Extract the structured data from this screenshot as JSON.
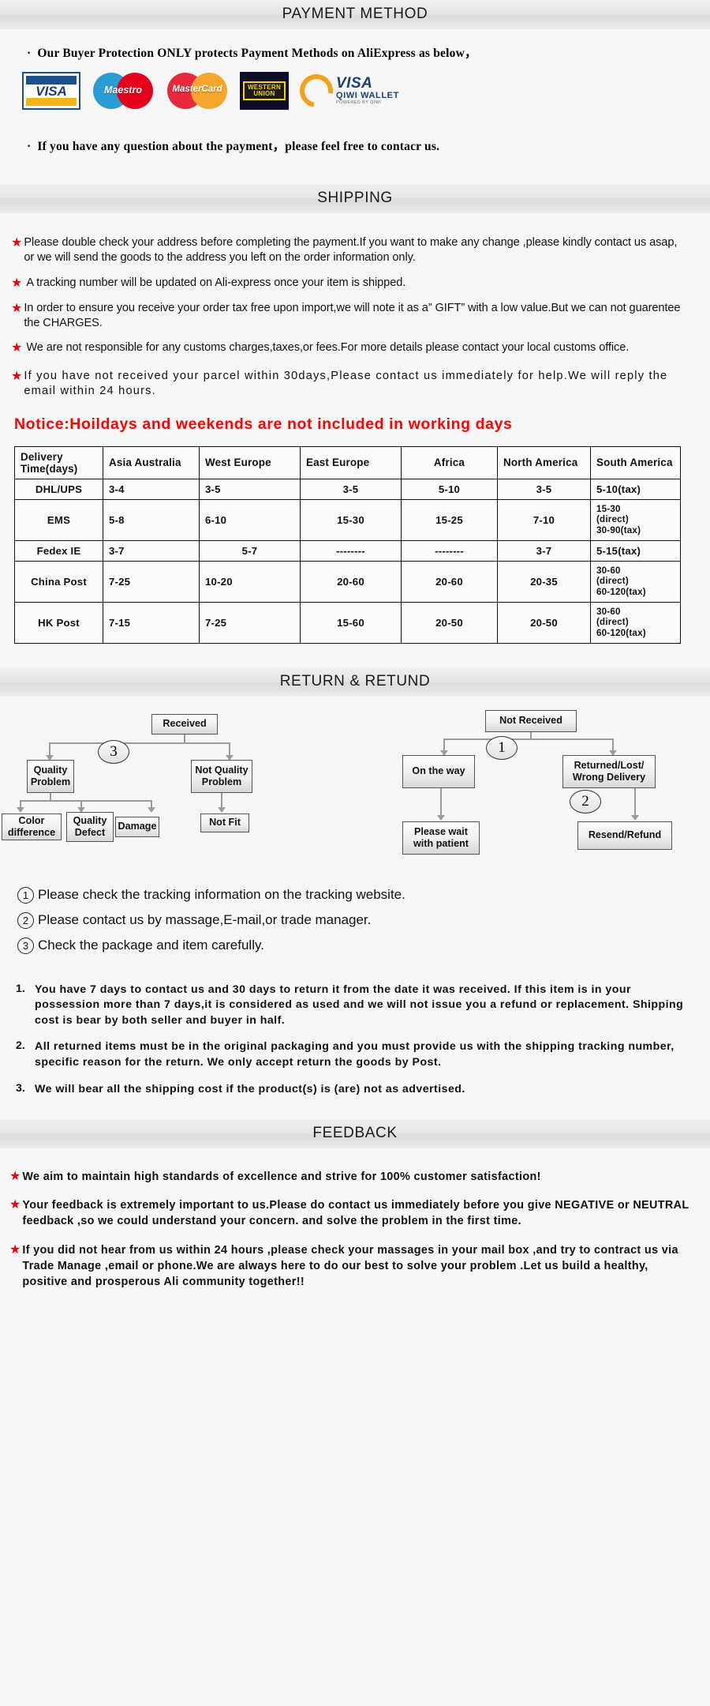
{
  "sections": {
    "payment_title": "PAYMENT METHOD",
    "shipping_title": "SHIPPING",
    "return_title": "RETURN & RETUND",
    "feedback_title": "FEEDBACK"
  },
  "payment": {
    "bullet_dot": "·",
    "line1": "Our Buyer Protection ONLY protects Payment Methods on AliExpress as below，",
    "line2": "If you have any question about the payment，please feel free to contacr us.",
    "logos": [
      {
        "name": "visa-logo",
        "label": "VISA"
      },
      {
        "name": "maestro-logo",
        "label": "Maestro"
      },
      {
        "name": "mastercard-logo",
        "label": "MasterCard"
      },
      {
        "name": "western-union-logo",
        "label_top": "WESTERN",
        "label_bottom": "UNION"
      },
      {
        "name": "qiwi-wallet-logo",
        "label": "VISA",
        "sub": "QIWI WALLET",
        "fine": "POWERED BY QIWI"
      }
    ]
  },
  "shipping": {
    "star": "★",
    "bullets": [
      {
        "text": "Please double check your address before completing the payment.If you want to make any change ,please kindly contact us asap, or we will send the goods to the address you left on the order information only.",
        "wide": false
      },
      {
        "text": "A tracking number will be updated on Ali-express once your item is shipped.",
        "wide": false
      },
      {
        "text": "In order to ensure you receive your order tax free upon import,we will note it as a” GIFT” with a low value.But we can not guarentee the CHARGES.",
        "wide": false
      },
      {
        "text": "We are not responsible for any customs charges,taxes,or fees.For more details please contact your local customs office.",
        "wide": false
      },
      {
        "text": "If you have not received your parcel within 30days,Please contact us immediately for help.We will reply the email within 24 hours.",
        "wide": true
      }
    ],
    "notice": "Notice:Hoildays and weekends are not included in working days",
    "table": {
      "headers": [
        "Delivery Time(days)",
        "Asia Australia",
        "West Europe",
        "East Europe",
        "Africa",
        "North America",
        "South America"
      ],
      "rows": [
        {
          "method": "DHL/UPS",
          "cells": [
            "3-4",
            "3-5",
            "3-5",
            "5-10",
            "3-5",
            "5-10(tax)"
          ]
        },
        {
          "method": "EMS",
          "cells": [
            "5-8",
            "6-10",
            "15-30",
            "15-25",
            "7-10",
            "15-30\n(direct)\n30-90(tax)"
          ]
        },
        {
          "method": "Fedex IE",
          "cells": [
            "3-7",
            "5-7",
            "--------",
            "--------",
            "3-7",
            "5-15(tax)"
          ]
        },
        {
          "method": "China Post",
          "cells": [
            "7-25",
            "10-20",
            "20-60",
            "20-60",
            "20-35",
            "30-60\n(direct)\n60-120(tax)"
          ]
        },
        {
          "method": "HK Post",
          "cells": [
            "7-15",
            "7-25",
            "15-60",
            "20-50",
            "20-50",
            "30-60\n(direct)\n60-120(tax)"
          ]
        }
      ]
    }
  },
  "returns": {
    "flow_left": {
      "received": "Received",
      "marker": "3",
      "quality_problem": "Quality Problem",
      "not_quality_problem": "Not Quality Problem",
      "color_difference": "Color difference",
      "quality_defect": "Quality Defect",
      "damage": "Damage",
      "not_fit": "Not Fit"
    },
    "flow_right": {
      "not_received": "Not  Received",
      "marker1": "1",
      "marker2": "2",
      "on_the_way": "On the way",
      "returned_lost": "Returned/Lost/ Wrong Delivery",
      "please_wait": "Please wait with patient",
      "resend_refund": "Resend/Refund"
    },
    "circled_list": [
      {
        "num": "①",
        "text": "Please check the tracking information on the tracking website."
      },
      {
        "num": "②",
        "text": "Please contact us by  massage,E-mail,or trade manager."
      },
      {
        "num": "③",
        "text": "Check the package and item carefully."
      }
    ],
    "policy": [
      {
        "num": "1.",
        "text": "You have 7 days to contact us and 30 days to return it from the date it was received. If this item is in your possession more than 7 days,it is considered as used and we will not issue you a refund or replacement. Shipping cost is bear by both seller and buyer in half."
      },
      {
        "num": "2.",
        "text": "All returned items must be in the original packaging and you must provide us with the shipping tracking number, specific reason for the return. We only accept return the goods by Post."
      },
      {
        "num": "3.",
        "text": "We will bear all the shipping cost if the product(s) is (are) not as advertised."
      }
    ]
  },
  "feedback": {
    "star": "★",
    "bullets": [
      "We aim to maintain high standards of excellence and strive  for 100% customer satisfaction!",
      "Your feedback is extremely important to us.Please do contact us immediately before you give NEGATIVE or NEUTRAL feedback ,so  we could understand your concern. and solve the problem in the first time.",
      "If you did not hear from us within 24 hours ,please check your massages in your mail box ,and try to contract us via Trade Manage ,email or phone.We are always here to do our best to solve your problem .Let us build a healthy, positive and prosperous Ali community together!!"
    ]
  },
  "colors": {
    "star_red": "#e8000c",
    "notice_red": "#ff0000",
    "header_bg": "#e6e6e6"
  }
}
